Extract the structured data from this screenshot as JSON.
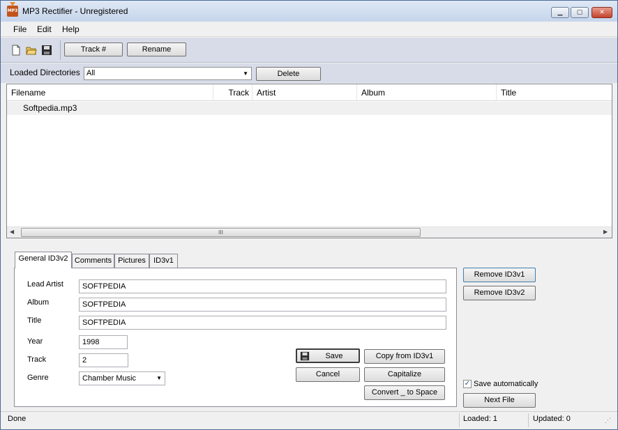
{
  "window": {
    "title": "MP3 Rectifier - Unregistered",
    "app_icon_text": "MP3",
    "minimize": "▁",
    "maximize": "▢",
    "close": "✕"
  },
  "menu": [
    "File",
    "Edit",
    "Help"
  ],
  "toolbar": {
    "icons": [
      "new-file-icon",
      "open-folder-icon",
      "save-icon"
    ],
    "track_button": "Track #",
    "rename_button": "Rename"
  },
  "directories": {
    "label": "Loaded Directories",
    "selected": "All",
    "delete_button": "Delete"
  },
  "file_list": {
    "columns": [
      "Filename",
      "Track",
      "Artist",
      "Album",
      "Title"
    ],
    "rows": [
      {
        "filename": "Softpedia.mp3",
        "track": "",
        "artist": "",
        "album": "",
        "title": ""
      }
    ],
    "scroll_grip": "III"
  },
  "tabs": [
    "General ID3v2",
    "Comments",
    "Pictures",
    "ID3v1"
  ],
  "form": {
    "lead_artist_label": "Lead Artist",
    "lead_artist": "SOFTPEDIA",
    "album_label": "Album",
    "album": "SOFTPEDIA",
    "title_label": "Title",
    "title": "SOFTPEDIA",
    "year_label": "Year",
    "year": "1998",
    "track_label": "Track",
    "track": "2",
    "genre_label": "Genre",
    "genre": "Chamber Music"
  },
  "actions": {
    "save": "Save",
    "cancel": "Cancel",
    "copy_from_id3v1": "Copy from ID3v1",
    "capitalize": "Capitalize",
    "convert": "Convert _ to Space",
    "remove_id3v1": "Remove ID3v1",
    "remove_id3v2": "Remove ID3v2",
    "save_automatically": "Save automatically",
    "save_automatically_checked": true,
    "next_file": "Next File"
  },
  "status": {
    "text": "Done",
    "loaded": "Loaded: 1",
    "updated": "Updated: 0"
  }
}
